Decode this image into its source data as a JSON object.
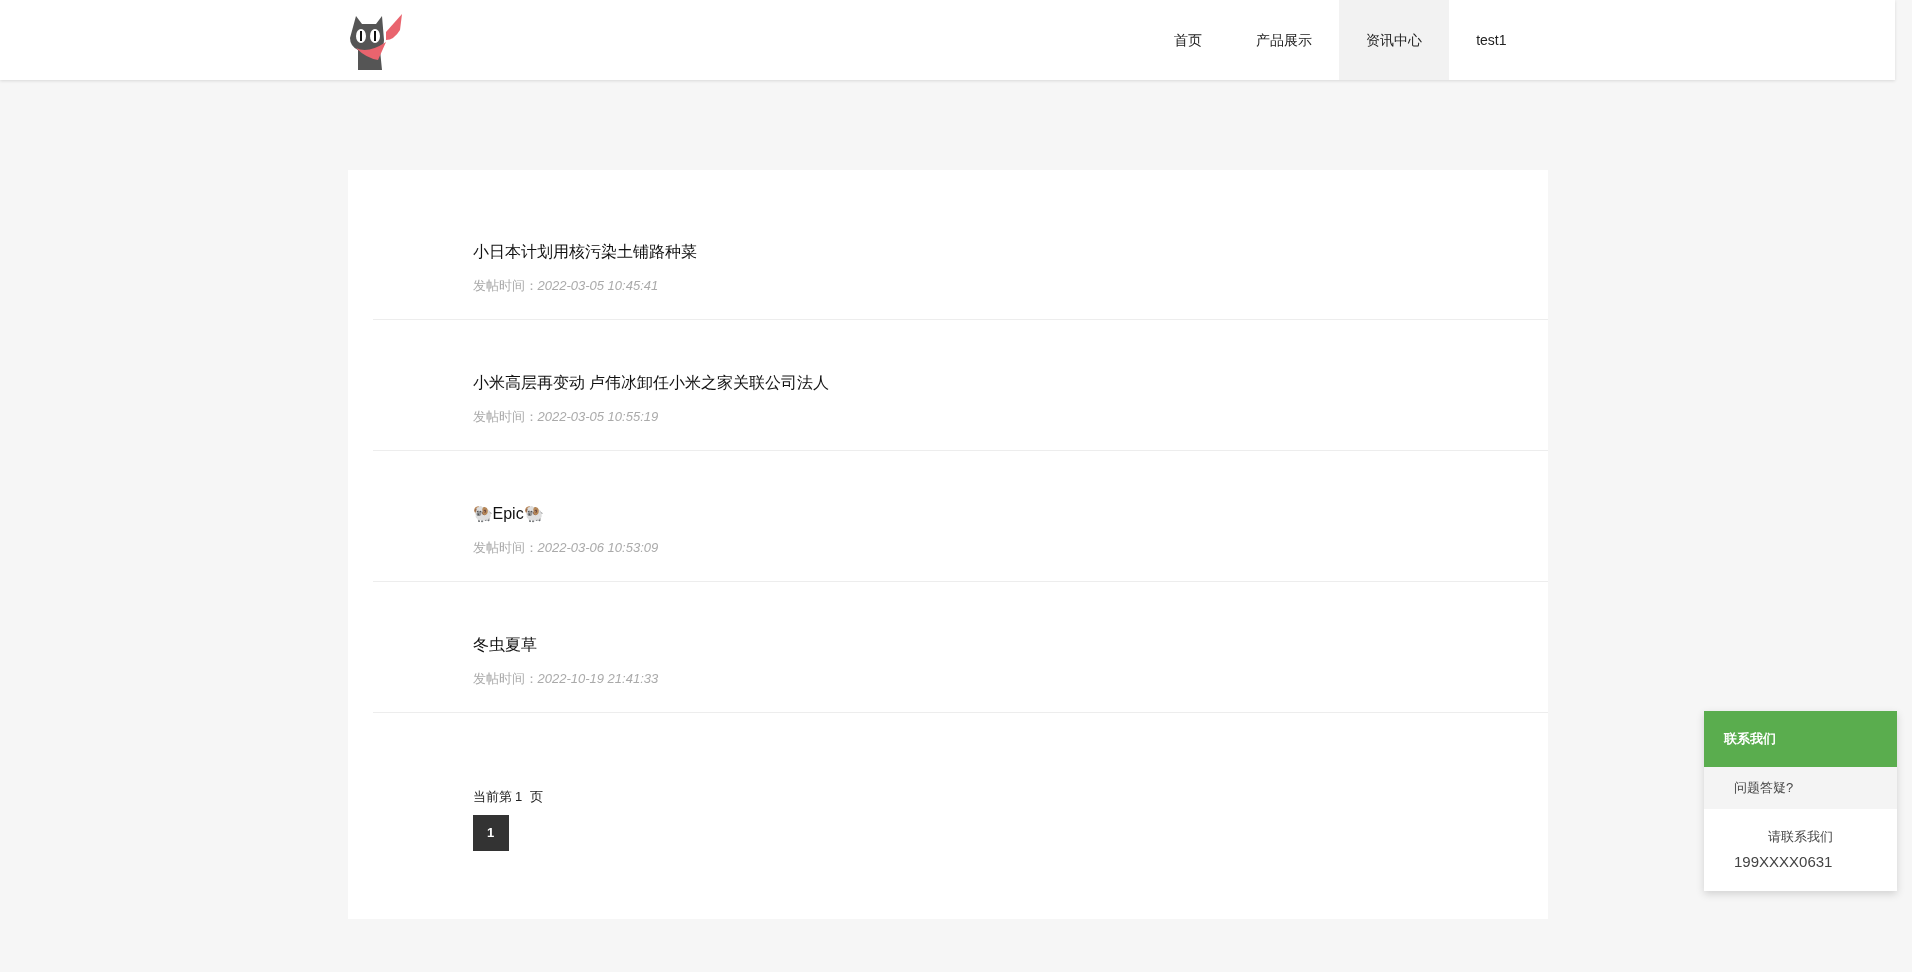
{
  "nav": [
    {
      "label": "首页",
      "selected": false
    },
    {
      "label": "产品展示",
      "selected": false
    },
    {
      "label": "资讯中心",
      "selected": true
    },
    {
      "label": "test1",
      "selected": false
    }
  ],
  "posts": [
    {
      "title": "小日本计划用核污染土铺路种菜",
      "label": "发帖时间：",
      "time": "2022-03-05 10:45:41"
    },
    {
      "title": "小米高层再变动 卢伟冰卸任小米之家关联公司法人",
      "label": "发帖时间：",
      "time": "2022-03-05 10:55:19"
    },
    {
      "title": "🐏Epic🐏",
      "label": "发帖时间：",
      "time": "2022-03-06 10:53:09"
    },
    {
      "title": "冬虫夏草",
      "label": "发帖时间：",
      "time": "2022-10-19 21:41:33"
    }
  ],
  "pager": {
    "text": "当前第 1  页",
    "pages": [
      {
        "label": "1",
        "selected": true
      }
    ]
  },
  "contact": {
    "title": "联系我们",
    "subtitle": "问题答疑?",
    "text": "请联系我们",
    "phone": "199XXXX0631"
  }
}
